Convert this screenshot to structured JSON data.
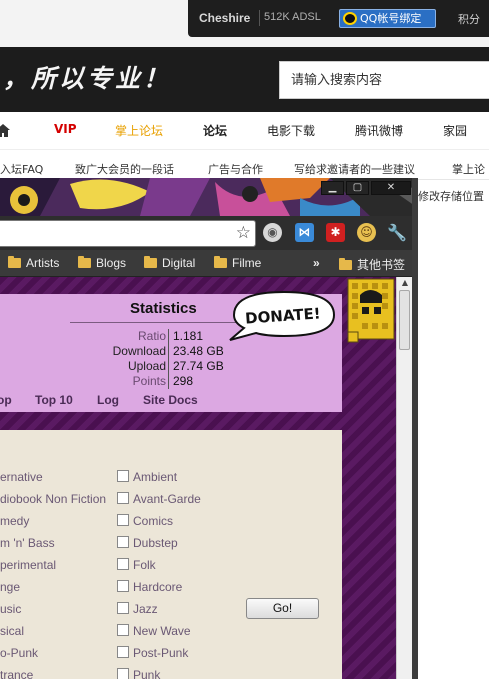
{
  "forum": {
    "user": "Cheshire",
    "network": "512K ADSL",
    "qq_bind": "QQ帐号绑定",
    "points_label": "积分",
    "slogan": "，所以专业！",
    "search_placeholder": "请输入搜索内容",
    "nav": [
      "VIP",
      "掌上论坛",
      "论坛",
      "电影下载",
      "腾讯微博",
      "家园"
    ],
    "subnav": [
      "入坛FAQ",
      "致广大会员的一段话",
      "广告与合作",
      "写给求邀请者的一些建议",
      "掌上论"
    ],
    "side_text": "修改存储位置"
  },
  "browser": {
    "bookmarks": [
      "Artists",
      "Blogs",
      "Digital",
      "Filme"
    ],
    "bookmarks_more": "»",
    "other_bookmarks": "其他书签",
    "window_controls": {
      "minimize": "▁",
      "maximize": "▢",
      "close": "✕"
    }
  },
  "site": {
    "stats_title": "Statistics",
    "stats": [
      {
        "label": "Ratio",
        "value": "1.181",
        "muted": true
      },
      {
        "label": "Download",
        "value": "23.48 GB",
        "muted": false
      },
      {
        "label": "Upload",
        "value": "27.74 GB",
        "muted": false
      },
      {
        "label": "Points",
        "value": "298",
        "muted": true
      }
    ],
    "stats_nav": [
      "op",
      "Top 10",
      "Log",
      "Site Docs"
    ],
    "donate_text": "DONATE!",
    "genres_left": [
      "ernative",
      "diobook Non Fiction",
      "medy",
      "m 'n' Bass",
      "perimental",
      "nge",
      "usic",
      "sical",
      "o-Punk",
      "trance"
    ],
    "genres_right": [
      "Ambient",
      "Avant-Garde",
      "Comics",
      "Dubstep",
      "Folk",
      "Hardcore",
      "Jazz",
      "New Wave",
      "Post-Punk",
      "Punk"
    ],
    "go_button": "Go!"
  },
  "colors": {
    "page_purple": "#4a1050",
    "stats_panel": "#dca8e2",
    "genre_panel": "#ece6d8",
    "vip_red": "#d40000",
    "accent_orange": "#e8a000"
  }
}
